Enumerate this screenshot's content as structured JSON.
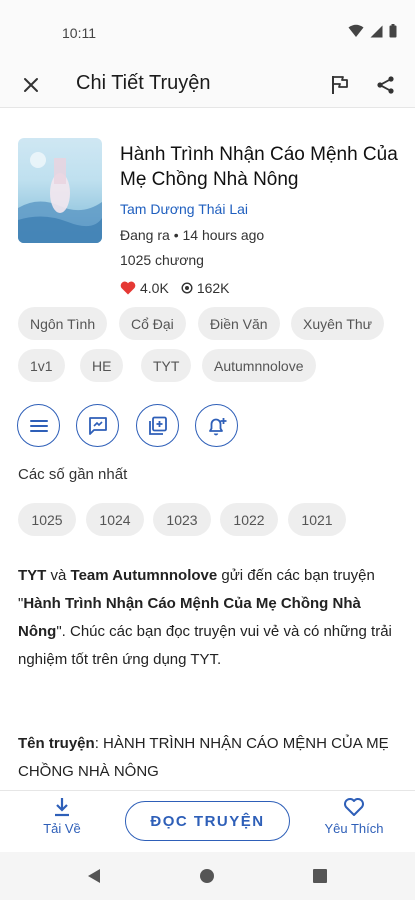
{
  "status": {
    "time": "10:11"
  },
  "header": {
    "title": "Chi Tiết Truyện"
  },
  "book": {
    "title": "Hành Trình Nhận Cáo Mệnh Của Mẹ Chồng Nhà Nông",
    "author": "Tam Dương Thái Lai",
    "status_line": "Đang ra • 14 hours ago",
    "chapters": "1025 chương",
    "likes": "4.0K",
    "views": "162K"
  },
  "tags": [
    "Ngôn Tình",
    "Cổ Đại",
    "Điền Văn",
    "Xuyên Thư",
    "1v1",
    "HE",
    "TYT",
    "Autumnnolove"
  ],
  "recent": {
    "label": "Các số gần nhất",
    "chapters": [
      "1025",
      "1024",
      "1023",
      "1022",
      "1021"
    ]
  },
  "description": {
    "p1": {
      "b1": "TYT",
      "t1": " và ",
      "b2": "Team Autumnnolove",
      "t2": " gửi đến các bạn truyện \"",
      "b3": "Hành Trình Nhận Cáo Mệnh Của Mẹ Chồng Nhà Nông",
      "t3": "\". Chúc các bạn đọc truyện vui vẻ và có những trải nghiệm tốt trên ứng dụng TYT."
    },
    "p2": {
      "b1": "Tên truyện",
      "t1": ": HÀNH TRÌNH NHẬN CÁO MỆNH CỦA MẸ CHỒNG NHÀ NÔNG"
    }
  },
  "bottom": {
    "download_label": "Tải Về",
    "read_label": "ĐỌC TRUYỆN",
    "favorite_label": "Yêu Thích"
  },
  "colors": {
    "accent": "#2e5fb8",
    "link": "#1f5fbf",
    "heart": "#e53935",
    "chip_bg": "#eeeeee"
  }
}
